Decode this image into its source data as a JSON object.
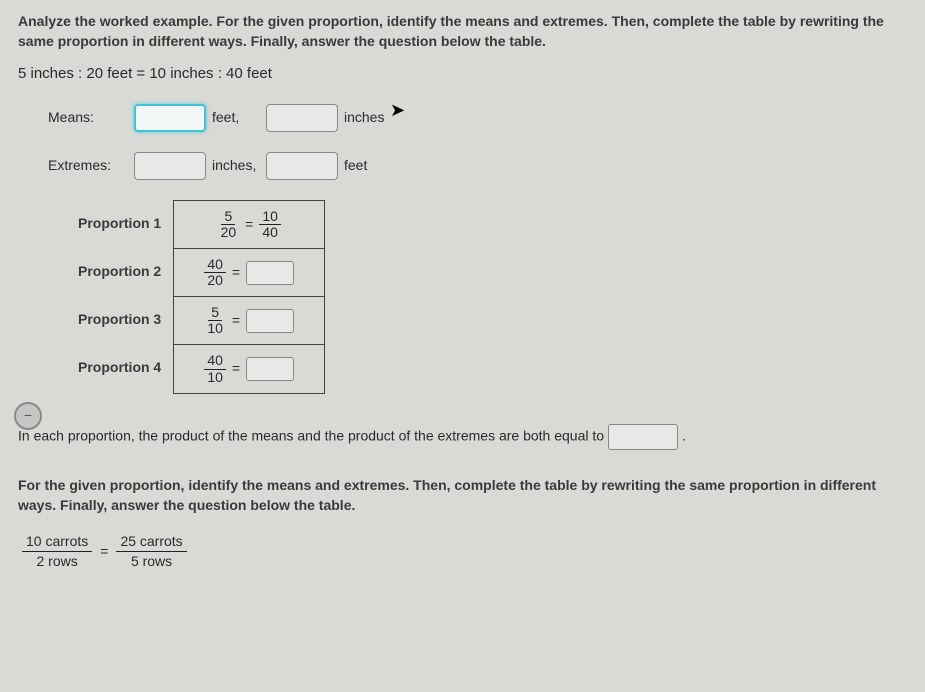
{
  "instruction1": "Analyze the worked example. For the given proportion, identify the means and extremes. Then, complete the table by rewriting the same proportion in different ways. Finally, answer the question below the table.",
  "ratio_line": "5 inches : 20 feet = 10 inches : 40 feet",
  "means": {
    "label": "Means:",
    "unit1": "feet,",
    "unit2": "inches"
  },
  "extremes": {
    "label": "Extremes:",
    "unit1": "inches,",
    "unit2": "feet"
  },
  "proportions": {
    "p1": {
      "label": "Proportion 1",
      "lhs_num": "5",
      "lhs_den": "20",
      "rhs_num": "10",
      "rhs_den": "40"
    },
    "p2": {
      "label": "Proportion 2",
      "lhs_num": "40",
      "lhs_den": "20"
    },
    "p3": {
      "label": "Proportion 3",
      "lhs_num": "5",
      "lhs_den": "10"
    },
    "p4": {
      "label": "Proportion 4",
      "lhs_num": "40",
      "lhs_den": "10"
    }
  },
  "eq": "=",
  "sentence_prefix": "In each proportion, the product of the means and the product of the extremes are both equal to ",
  "sentence_suffix": ".",
  "instruction2": "For the given proportion, identify the means and extremes. Then, complete the table by rewriting the same proportion in different ways. Finally, answer the question below the table.",
  "ratio2": {
    "l_num": "10 carrots",
    "l_den": "2 rows",
    "r_num": "25 carrots",
    "r_den": "5 rows"
  },
  "side_tab": "−"
}
